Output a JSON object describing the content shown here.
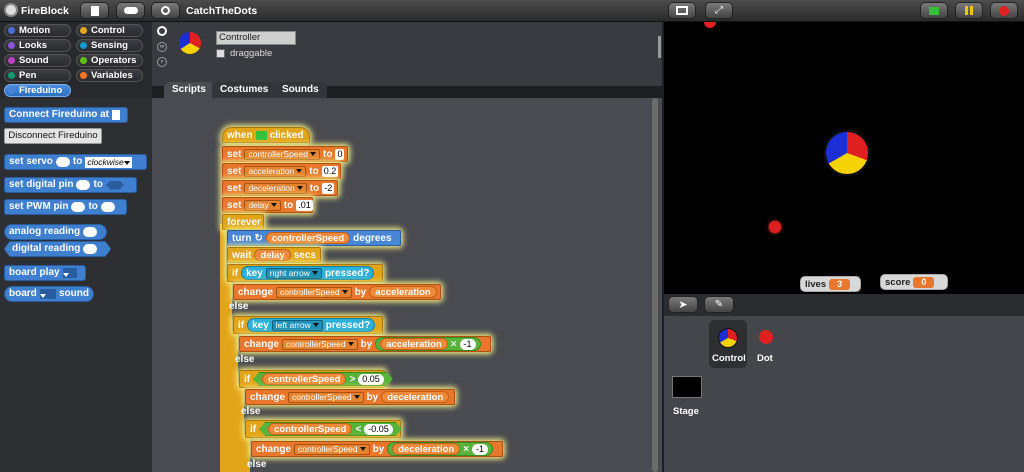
{
  "app": {
    "name": "FireBlock",
    "project_title": "CatchTheDots"
  },
  "categories": [
    {
      "label": "Motion",
      "color": "#4a6cd4"
    },
    {
      "label": "Control",
      "color": "#e1a91a"
    },
    {
      "label": "Looks",
      "color": "#8a55d7"
    },
    {
      "label": "Sensing",
      "color": "#0e9ace"
    },
    {
      "label": "Sound",
      "color": "#bb42c3"
    },
    {
      "label": "Operators",
      "color": "#62c213"
    },
    {
      "label": "Pen",
      "color": "#0e9a6c"
    },
    {
      "label": "Variables",
      "color": "#f3761d"
    },
    {
      "label": "Fireduino",
      "color": "#4a86d6"
    }
  ],
  "palette": {
    "connect": "Connect Fireduino at",
    "disconnect": "Disconnect Fireduino",
    "set_servo": "set servo",
    "to": "to",
    "clockwise": "clockwise",
    "set_digital_pin": "set digital pin",
    "set_pwm_pin": "set PWM pin",
    "analog_reading": "analog reading",
    "digital_reading": "digital reading",
    "board_play": "board play",
    "board": "board",
    "sound": "sound"
  },
  "sprite": {
    "name_value": "Controller",
    "draggable_label": "draggable"
  },
  "tabs": [
    "Scripts",
    "Costumes",
    "Sounds"
  ],
  "script": {
    "when": "when",
    "clicked": "clicked",
    "set": "set",
    "to": "to",
    "controllerSpeed": "controllerSpeed",
    "acceleration": "acceleration",
    "deceleration": "deceleration",
    "delay": "delay",
    "v_speed": "0",
    "v_accel": "0.2",
    "v_decel": "-2",
    "v_delay": ".01",
    "forever": "forever",
    "turn": "turn",
    "degrees": "degrees",
    "wait": "wait",
    "secs": "secs",
    "if": "if",
    "else": "else",
    "key": "key",
    "right_arrow": "right arrow",
    "left_arrow": "left arrow",
    "pressed": "pressed?",
    "change": "change",
    "by": "by",
    "gt": ">",
    "lt": "<",
    "times": "×",
    "v_005": "0.05",
    "v_n005": "-0.05",
    "v_n1": "-1"
  },
  "stage": {
    "lives_label": "lives",
    "lives_value": "3",
    "score_label": "score",
    "score_value": "0"
  },
  "sprites": {
    "control": "Control",
    "dot": "Dot",
    "stage": "Stage"
  }
}
